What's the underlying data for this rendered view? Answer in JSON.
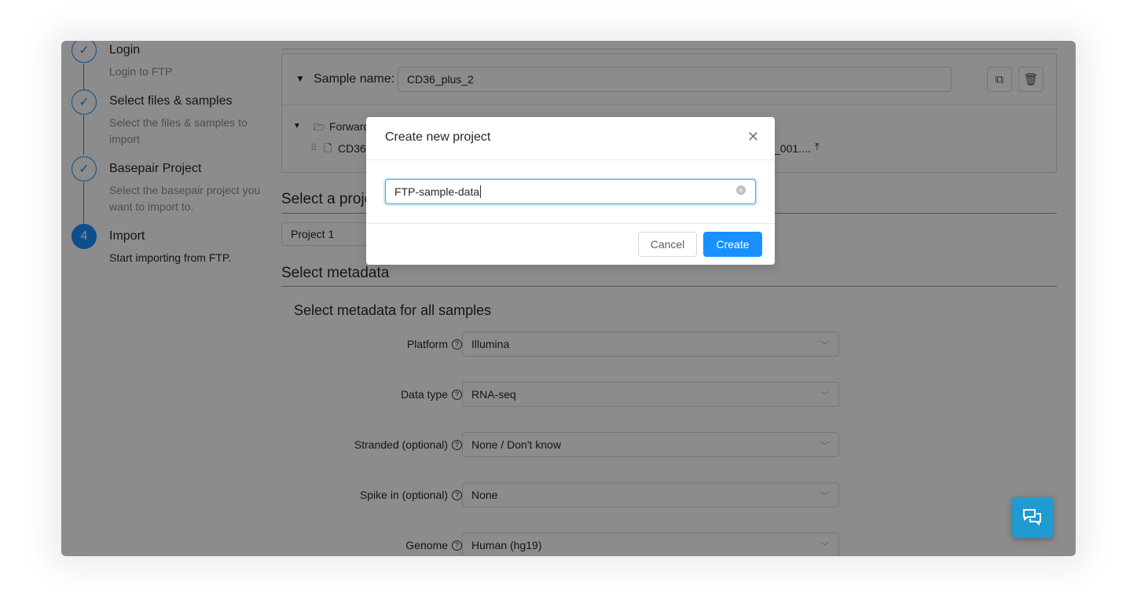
{
  "steps": [
    {
      "title": "Login",
      "desc": "Login to FTP",
      "status": "done"
    },
    {
      "title": "Select files & samples",
      "desc": "Select the files & samples to import",
      "status": "done"
    },
    {
      "title": "Basepair Project",
      "desc": "Select the basepair project you want to import to.",
      "status": "done"
    },
    {
      "title": "Import",
      "desc": "Start importing from FTP.",
      "number": "4",
      "status": "current"
    }
  ],
  "sample": {
    "label": "Sample name:",
    "value": "CD36_plus_2",
    "folder": "Forward",
    "file_start": "CD36",
    "file_end": "_001...."
  },
  "project": {
    "heading": "Select a project",
    "selected": "Project 1"
  },
  "metadata": {
    "heading": "Select metadata",
    "subheading": "Select metadata for all samples",
    "fields": [
      {
        "label": "Platform",
        "value": "Illumina"
      },
      {
        "label": "Data type",
        "value": "RNA-seq"
      },
      {
        "label": "Stranded (optional)",
        "value": "None / Don't know"
      },
      {
        "label": "Spike in (optional)",
        "value": "None"
      },
      {
        "label": "Genome",
        "value": "Human (hg19)"
      }
    ]
  },
  "modal": {
    "title": "Create new project",
    "input_value": "FTP-sample-data",
    "cancel": "Cancel",
    "create": "Create"
  },
  "colors": {
    "primary": "#1890ff",
    "chat": "#1f9bd1"
  }
}
